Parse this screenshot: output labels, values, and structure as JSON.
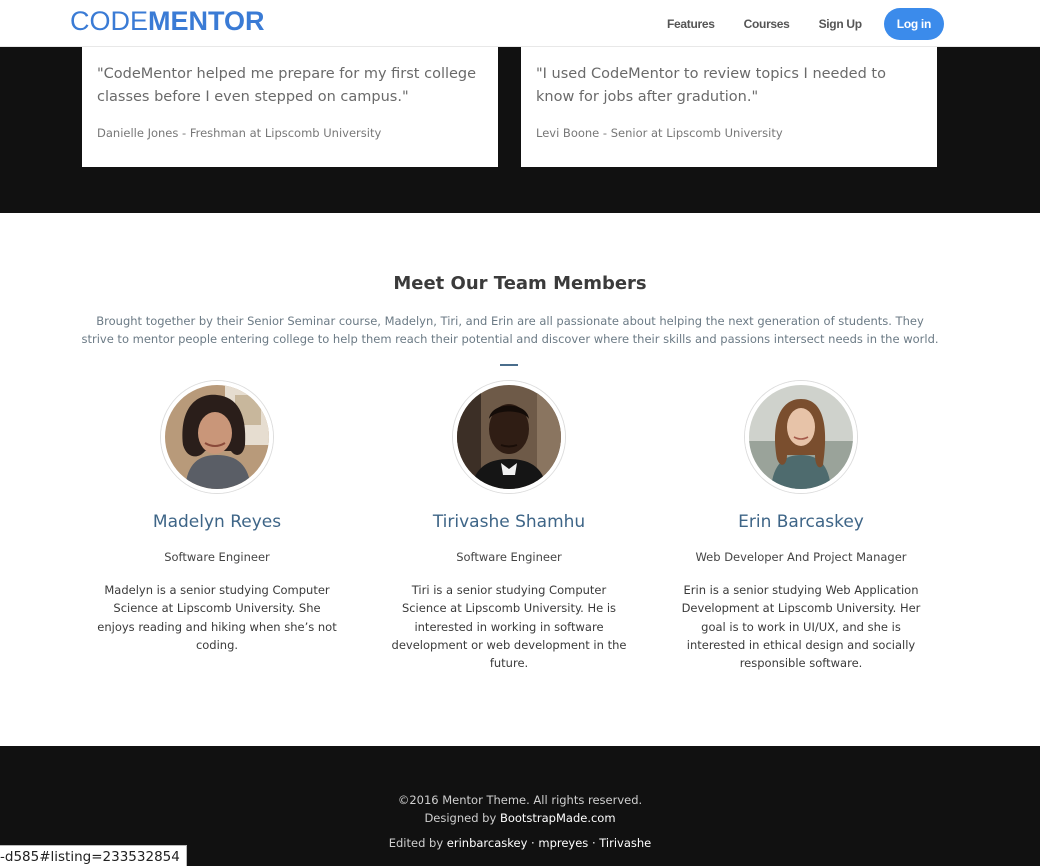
{
  "header": {
    "logo_part1": "CODE",
    "logo_part2": "MENTOR",
    "nav": {
      "features": "Features",
      "courses": "Courses",
      "signup": "Sign Up",
      "login": "Log in"
    }
  },
  "testimonials": [
    {
      "quote": "\"CodeMentor helped me prepare for my first college classes before I even stepped on campus.\"",
      "author": "Danielle Jones - Freshman at Lipscomb University"
    },
    {
      "quote": "\"I used CodeMentor to review topics I needed to know for jobs after gradution.\"",
      "author": "Levi Boone - Senior at Lipscomb University"
    }
  ],
  "team": {
    "title": "Meet Our Team Members",
    "intro": "Brought together by their Senior Seminar course, Madelyn, Tiri, and Erin are all passionate about helping the next generation of students. They strive to mentor people entering college to help them reach their potential and discover where their skills and passions intersect needs in the world.",
    "members": [
      {
        "name": "Madelyn Reyes",
        "role": "Software Engineer",
        "bio": "Madelyn is a senior studying Computer Science at Lipscomb University. She enjoys reading and hiking when she’s not coding."
      },
      {
        "name": "Tirivashe Shamhu",
        "role": "Software Engineer",
        "bio": "Tiri is a senior studying Computer Science at Lipscomb University. He is interested in working in software development or web development in the future."
      },
      {
        "name": "Erin Barcaskey",
        "role": "Web Developer And Project Manager",
        "bio": "Erin is a senior studying Web Application Development at Lipscomb University. Her goal is to work in UI/UX, and she is interested in ethical design and socially responsible software."
      }
    ]
  },
  "footer": {
    "copyright": "©2016 Mentor Theme. All rights reserved.",
    "designed_prefix": "Designed by ",
    "designed_link": "BootstrapMade.com",
    "edited_prefix": "Edited by ",
    "edited_links": "erinbarcaskey · mpreyes · Tirivashe"
  },
  "status_url": "-d585#listing=233532854",
  "colors": {
    "brand_blue": "#3a7bd5",
    "login_button": "#3b8beb",
    "dark_band": "#111111",
    "member_name": "#3e6587"
  },
  "icons": {
    "member_photos": [
      "avatar-photo",
      "avatar-photo",
      "avatar-photo"
    ]
  }
}
